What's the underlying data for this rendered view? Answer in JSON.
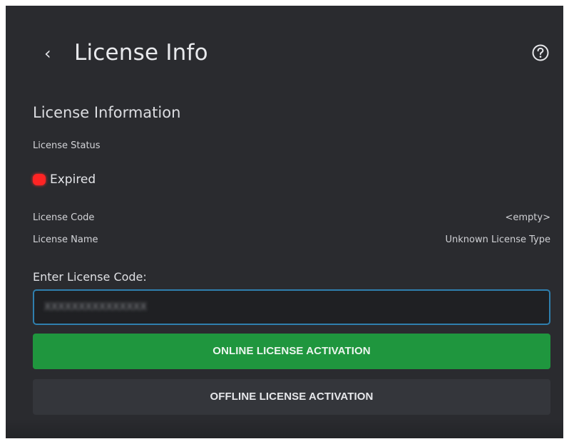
{
  "header": {
    "back_icon": "chevron-left-icon",
    "back_glyph": "‹",
    "title": "License Info",
    "help_icon": "question-circle-icon"
  },
  "section": {
    "title": "License Information"
  },
  "license_status": {
    "label": "License Status",
    "value": "Expired",
    "indicator_color": "#ff2424"
  },
  "license_code": {
    "label": "License Code",
    "value": "<empty>"
  },
  "license_name": {
    "label": "License Name",
    "value": "Unknown License Type"
  },
  "license_input": {
    "label": "Enter License Code:",
    "value": "XXXXXXXXXXXXXXX"
  },
  "buttons": {
    "online": "ONLINE LICENSE ACTIVATION",
    "offline": "OFFLINE LICENSE ACTIVATION"
  },
  "colors": {
    "background": "#2a2b2f",
    "accent_green": "#1f963e",
    "input_border": "#2f7fae"
  }
}
